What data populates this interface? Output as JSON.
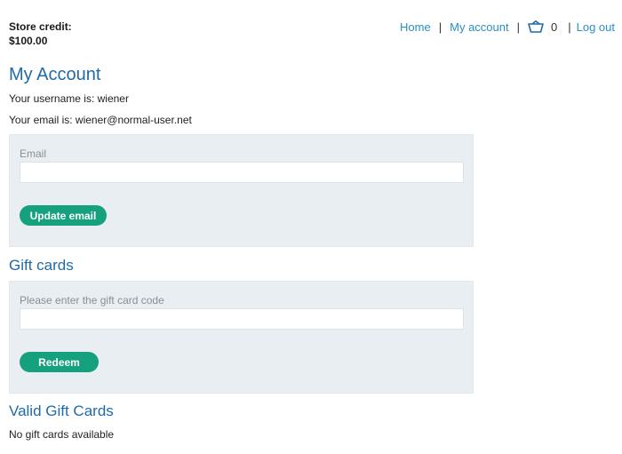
{
  "store_credit": {
    "label": "Store credit:",
    "amount": "$100.00"
  },
  "nav": {
    "home": "Home",
    "my_account": "My account",
    "cart_count": "0",
    "logout": "Log out",
    "separator": "|"
  },
  "account": {
    "title": "My Account",
    "username_line": "Your username is: wiener",
    "email_line": "Your email is: wiener@normal-user.net"
  },
  "email_form": {
    "label": "Email",
    "value": "",
    "button": "Update email"
  },
  "gift_cards": {
    "title": "Gift cards",
    "label": "Please enter the gift card code",
    "value": "",
    "button": "Redeem"
  },
  "valid_gift_cards": {
    "title": "Valid Gift Cards",
    "empty_message": "No gift cards available"
  },
  "colors": {
    "link": "#2b8fc4",
    "heading": "#1f6ba8",
    "button": "#15a17e",
    "panel": "#e8eef1"
  }
}
